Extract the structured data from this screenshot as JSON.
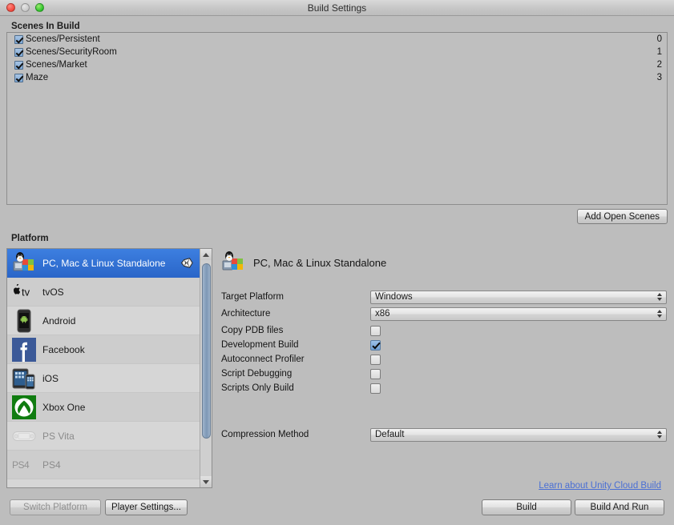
{
  "window": {
    "title": "Build Settings",
    "traffic_lights": [
      "close-light",
      "minimize-light",
      "zoom-light"
    ]
  },
  "scenes_section": {
    "header": "Scenes In Build",
    "add_open_scenes_label": "Add Open Scenes",
    "rows": [
      {
        "name": "Scenes/Persistent",
        "index": "0",
        "checked": true
      },
      {
        "name": "Scenes/SecurityRoom",
        "index": "1",
        "checked": true
      },
      {
        "name": "Scenes/Market",
        "index": "2",
        "checked": true
      },
      {
        "name": "Maze",
        "index": "3",
        "checked": true
      }
    ]
  },
  "platform_section": {
    "header": "Platform",
    "items": [
      {
        "label": "PC, Mac & Linux Standalone",
        "icon": "pc-mac-linux-icon",
        "selected": true,
        "enabled": true,
        "unity_badge": true
      },
      {
        "label": "tvOS",
        "icon": "appletv-icon",
        "selected": false,
        "enabled": true,
        "unity_badge": false
      },
      {
        "label": "Android",
        "icon": "android-icon",
        "selected": false,
        "enabled": true,
        "unity_badge": false
      },
      {
        "label": "Facebook",
        "icon": "facebook-icon",
        "selected": false,
        "enabled": true,
        "unity_badge": false
      },
      {
        "label": "iOS",
        "icon": "ios-icon",
        "selected": false,
        "enabled": true,
        "unity_badge": false
      },
      {
        "label": "Xbox One",
        "icon": "xbox-icon",
        "selected": false,
        "enabled": true,
        "unity_badge": false
      },
      {
        "label": "PS Vita",
        "icon": "psvita-icon",
        "selected": false,
        "enabled": false,
        "unity_badge": false
      },
      {
        "label": "PS4",
        "icon": "ps4-icon",
        "selected": false,
        "enabled": false,
        "unity_badge": false
      },
      {
        "label": "",
        "icon": "html5-icon",
        "selected": false,
        "enabled": true,
        "unity_badge": false
      }
    ]
  },
  "settings_panel": {
    "platform_title": "PC, Mac & Linux Standalone",
    "target_platform": {
      "label": "Target Platform",
      "value": "Windows"
    },
    "architecture": {
      "label": "Architecture",
      "value": "x86"
    },
    "checkboxes": [
      {
        "label": "Copy PDB files",
        "checked": false
      },
      {
        "label": "Development Build",
        "checked": true
      },
      {
        "label": "Autoconnect Profiler",
        "checked": false
      },
      {
        "label": "Script Debugging",
        "checked": false
      },
      {
        "label": "Scripts Only Build",
        "checked": false
      }
    ],
    "compression_method": {
      "label": "Compression Method",
      "value": "Default"
    }
  },
  "footer": {
    "cloud_build_link": "Learn about Unity Cloud Build",
    "switch_platform_label": "Switch Platform",
    "player_settings_label": "Player Settings...",
    "build_label": "Build",
    "build_and_run_label": "Build And Run"
  },
  "colors": {
    "background": "#bdbdbd",
    "selection_blue": "#2a66c9",
    "link_blue": "#4a6fd4",
    "checkbox_blue": "#7ea9d8"
  }
}
